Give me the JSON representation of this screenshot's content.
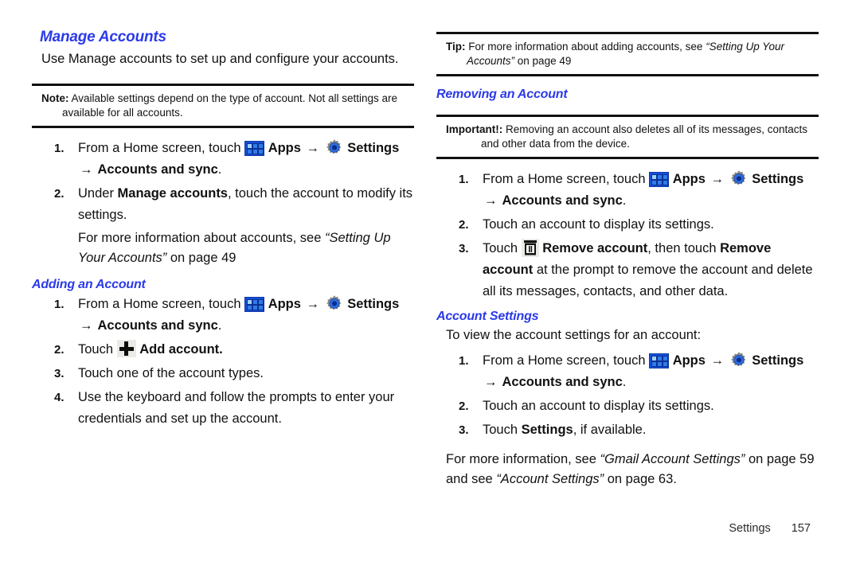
{
  "colors": {
    "heading_blue": "#2b3ae8",
    "apps_icon_blue": "#1450d8",
    "gear_blue": "#1a4fd8",
    "text_black": "#111111"
  },
  "icons": {
    "apps": "apps-grid-icon",
    "settings": "gear-icon",
    "add": "plus-icon",
    "remove": "trash-icon",
    "arrow": "→"
  },
  "left_column": {
    "section_heading": "Manage Accounts",
    "intro": "Use Manage accounts to set up and configure your accounts.",
    "note": {
      "lead": "Note:",
      "line1": "Available settings depend on the type of account. Not all settings are",
      "line2": "available for all accounts."
    },
    "manage_steps": [
      {
        "num": "1.",
        "pre": "From a Home screen, touch",
        "apps_label": "Apps",
        "settings_label": "Settings",
        "tail_bold": "Accounts and sync",
        "tail_end": "."
      },
      {
        "num": "2.",
        "pre": "Under ",
        "bold1": "Manage accounts",
        "post": ", touch the account to modify its settings."
      }
    ],
    "manage_followup": {
      "pre": "For more information about accounts, see ",
      "italic": "“Setting Up Your Accounts”",
      "post": " on page 49"
    },
    "adding_heading": "Adding an Account",
    "adding_steps": [
      {
        "num": "1.",
        "pre": "From a Home screen, touch",
        "apps_label": "Apps",
        "settings_label": "Settings",
        "tail_bold": "Accounts and sync",
        "tail_end": "."
      },
      {
        "num": "2.",
        "pre": "Touch",
        "bold_after_icon": "Add account."
      },
      {
        "num": "3.",
        "text": "Touch one of the account types."
      },
      {
        "num": "4.",
        "text": "Use the keyboard and follow the prompts to enter your credentials and set up the account."
      }
    ]
  },
  "right_column": {
    "tip": {
      "lead": "Tip:",
      "line1_pre": "For more information about adding accounts, see ",
      "line1_italic": "“Setting Up Your",
      "line2_italic": "Accounts”",
      "line2_post": " on page 49"
    },
    "removing_heading": "Removing an Account",
    "important": {
      "lead": "Important!:",
      "line1": "Removing an account also deletes all of its messages, contacts",
      "line2": "and other data from the device."
    },
    "removing_steps": [
      {
        "num": "1.",
        "pre": "From a Home screen, touch",
        "apps_label": "Apps",
        "settings_label": "Settings",
        "tail_bold": "Accounts and sync",
        "tail_end": "."
      },
      {
        "num": "2.",
        "text": "Touch an account to display its settings."
      },
      {
        "num": "3.",
        "pre": "Touch",
        "bold1": "Remove account",
        "mid": ", then touch ",
        "bold2": "Remove account",
        "post": " at the prompt to remove the account and delete all its messages, contacts, and other data."
      }
    ],
    "account_settings_heading": "Account Settings",
    "account_settings_intro": "To view the account settings for an account:",
    "account_settings_steps": [
      {
        "num": "1.",
        "pre": "From a Home screen, touch",
        "apps_label": "Apps",
        "settings_label": "Settings",
        "tail_bold": "Accounts and sync",
        "tail_end": "."
      },
      {
        "num": "2.",
        "text": "Touch an account to display its settings."
      },
      {
        "num": "3.",
        "pre": "Touch ",
        "bold1": "Settings",
        "post": ", if available."
      }
    ],
    "closing": {
      "pre": "For more information, see ",
      "italic1": "“Gmail Account Settings”",
      "mid": " on page 59 and see ",
      "italic2": "“Account Settings”",
      "post": " on page 63."
    }
  },
  "footer": {
    "chapter": "Settings",
    "page_number": "157"
  }
}
